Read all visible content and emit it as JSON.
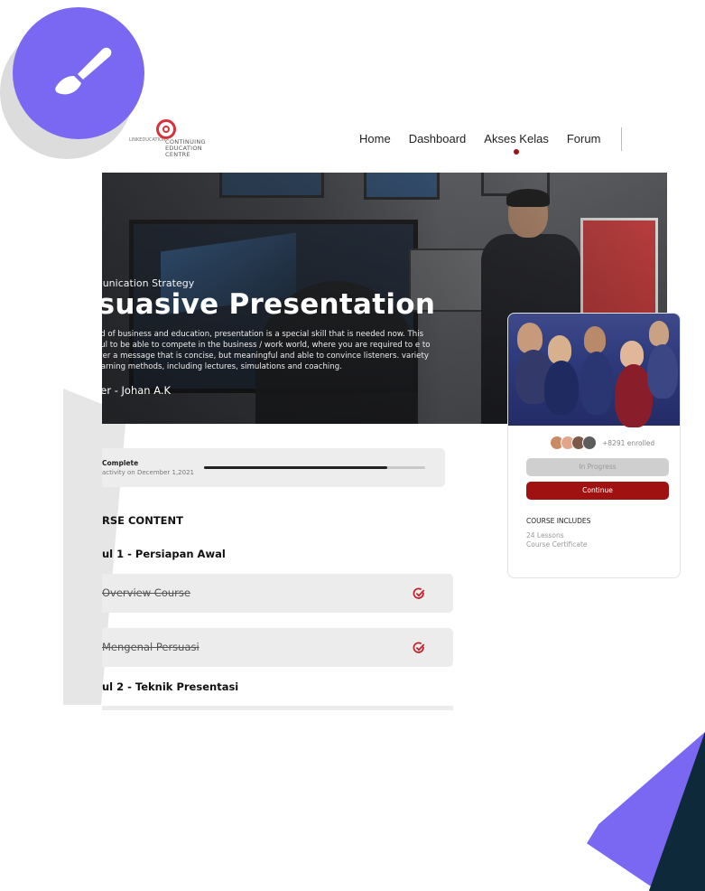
{
  "brand": {
    "logo_text": "CONTINUING\nEDUCATION\nCENTRE",
    "logo_small": "LINKEDUCATION"
  },
  "nav": {
    "items": [
      {
        "label": "Home"
      },
      {
        "label": "Dashboard"
      },
      {
        "label": "Akses Kelas"
      },
      {
        "label": "Forum"
      }
    ],
    "active": "Akses Kelas"
  },
  "hero": {
    "category": "munication Strategy",
    "title": "rsuasive Presentation",
    "description": "world of business and education, presentation is a special skill that is needed now. This useful to be able to compete in the business / work world, where you are required to e to deliver a message that is concise, but meaningful and able to convince listeners. variety of learning methods, including lectures, simulations and coaching.",
    "speaker": "ker - Johan A.K"
  },
  "progress": {
    "label": "Complete",
    "last_activity": "activity on December 1,2021",
    "fraction": 0.83
  },
  "content": {
    "section_title": "RSE CONTENT",
    "modules": [
      {
        "title": "ul 1 - Persiapan Awal",
        "lessons": [
          {
            "name": "Overview Course"
          },
          {
            "name": "Mengenal Persuasi"
          }
        ]
      },
      {
        "title": "ul 2 - Teknik Presentasi",
        "lessons": []
      }
    ]
  },
  "course_card": {
    "enrolled": "+8291 enrolled",
    "in_progress_label": "In Progress",
    "continue_label": "Continue",
    "includes_title": "COURSE INCLUDES",
    "includes": [
      "24 Lessons",
      "Course Certificate"
    ]
  },
  "colors": {
    "accent": "#a01212",
    "deco_purple": "#7a68f2",
    "deco_dark": "#0e2a3a"
  },
  "icons": {
    "deco_circle": "paintbrush-icon",
    "lesson_status": "check-circle-icon"
  }
}
